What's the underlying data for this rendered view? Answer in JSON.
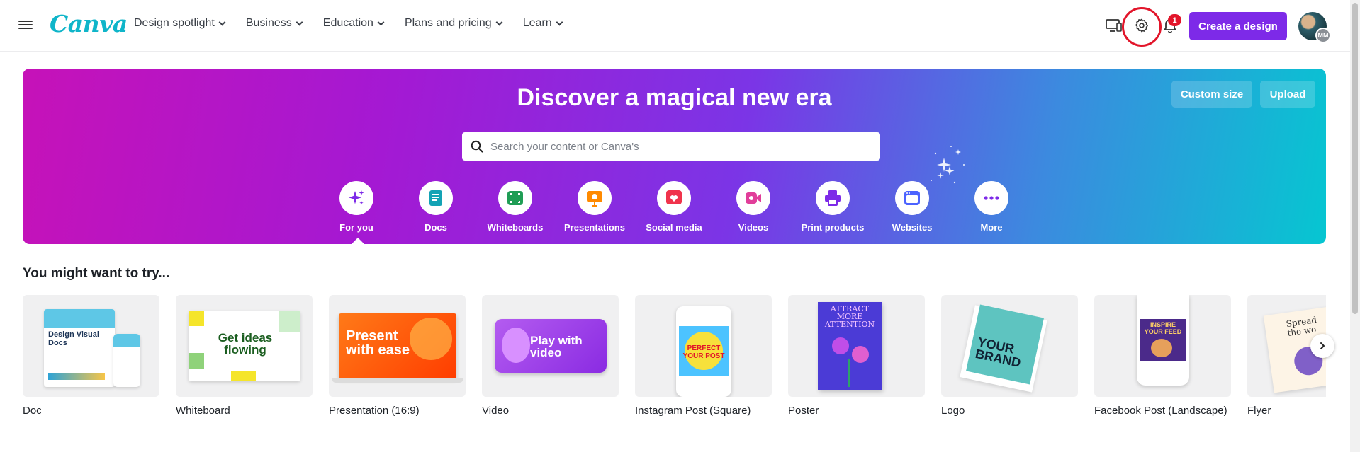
{
  "header": {
    "logo": "Canva",
    "nav": [
      {
        "label": "Design spotlight"
      },
      {
        "label": "Business"
      },
      {
        "label": "Education"
      },
      {
        "label": "Plans and pricing"
      },
      {
        "label": "Learn"
      }
    ],
    "notification_count": "1",
    "create_button": "Create a design",
    "avatar_initials": "MM",
    "icons": [
      "menu-icon",
      "desktop-app-icon",
      "settings-gear-icon",
      "bell-icon"
    ]
  },
  "hero": {
    "title": "Discover a magical new era",
    "search_placeholder": "Search your content or Canva's",
    "custom_size": "Custom size",
    "upload": "Upload",
    "categories": [
      {
        "label": "For you",
        "icon": "sparkle-icon",
        "color": "#7d2ae8"
      },
      {
        "label": "Docs",
        "icon": "doc-icon",
        "color": "#13a3b5"
      },
      {
        "label": "Whiteboards",
        "icon": "whiteboard-icon",
        "color": "#1f9d55"
      },
      {
        "label": "Presentations",
        "icon": "presentation-icon",
        "color": "#ff8a00"
      },
      {
        "label": "Social media",
        "icon": "heart-icon",
        "color": "#f0334c"
      },
      {
        "label": "Videos",
        "icon": "video-icon",
        "color": "#e13e9a"
      },
      {
        "label": "Print products",
        "icon": "printer-icon",
        "color": "#7d2ae8"
      },
      {
        "label": "Websites",
        "icon": "website-icon",
        "color": "#4c63ff"
      },
      {
        "label": "More",
        "icon": "more-dots-icon",
        "color": "#7d2ae8"
      }
    ]
  },
  "suggestions": {
    "title": "You might want to try...",
    "items": [
      {
        "label": "Doc",
        "art": "Design Visual Docs"
      },
      {
        "label": "Whiteboard",
        "art": "Get ideas flowing"
      },
      {
        "label": "Presentation (16:9)",
        "art": "Present with ease"
      },
      {
        "label": "Video",
        "art": "Play with video"
      },
      {
        "label": "Instagram Post (Square)",
        "art": "PERFECT YOUR POST"
      },
      {
        "label": "Poster",
        "art": "ATTRACT MORE ATTENTION"
      },
      {
        "label": "Logo",
        "art": "YOUR BRAND"
      },
      {
        "label": "Facebook Post (Landscape)",
        "art": "INSPIRE YOUR FEED"
      },
      {
        "label": "Flyer",
        "art": "Spread the wo"
      }
    ]
  },
  "colors": {
    "accent": "#7d2ae8",
    "notification": "#e2152a",
    "highlight_ring": "#e2152a"
  }
}
